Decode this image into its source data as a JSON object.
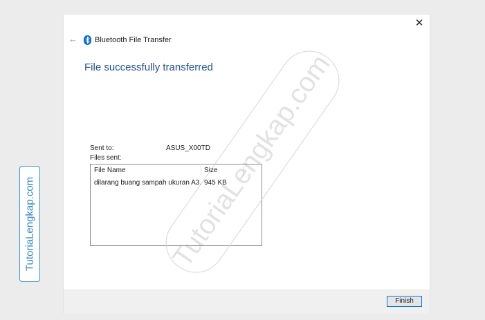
{
  "window": {
    "title": "Bluetooth File Transfer",
    "close_glyph": "✕",
    "back_glyph": "←",
    "icons": [
      "back-arrow-icon",
      "bluetooth-icon",
      "close-icon"
    ]
  },
  "heading": "File successfully transferred",
  "sent_to": {
    "label": "Sent to:",
    "value": "ASUS_X00TD"
  },
  "files_sent_label": "Files sent:",
  "files_table": {
    "columns": [
      "File Name",
      "Size"
    ],
    "rows": [
      {
        "name": "dilarang buang sampah ukuran A3...",
        "size": "945 KB"
      }
    ]
  },
  "footer": {
    "finish_label": "Finish"
  },
  "watermark": {
    "side_label": "TutoriaLengkap.com",
    "diagonal_label": "TutoriaLengkap.com"
  },
  "colors": {
    "accent": "#0078d7",
    "heading": "#1f4f9e",
    "bluetooth": "#0a6fd8",
    "watermark": "#2f86d0"
  }
}
